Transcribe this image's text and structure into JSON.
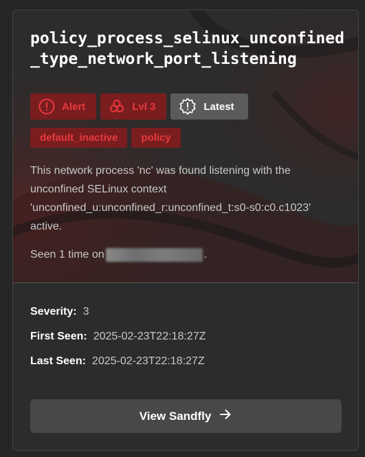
{
  "card": {
    "title": "policy_process_selinux_unconfined_type_network_port_listening",
    "badges": [
      {
        "label": "Alert",
        "icon": "alert-circle-icon",
        "style": "red"
      },
      {
        "label": "Lvl 3",
        "icon": "biohazard-icon",
        "style": "red"
      },
      {
        "label": "Latest",
        "icon": "starburst-alert-icon",
        "style": "grey"
      }
    ],
    "tags": [
      "default_inactive",
      "policy"
    ],
    "description": "This network process 'nc' was found listening with the unconfined SELinux context 'unconfined_u:unconfined_r:unconfined_t:s0-s0:c0.c1023' active.",
    "seen_prefix": "Seen 1 time on",
    "seen_suffix": "."
  },
  "details": {
    "severity_label": "Severity:",
    "severity_value": "3",
    "first_seen_label": "First Seen:",
    "first_seen_value": "2025-02-23T22:18:27Z",
    "last_seen_label": "Last Seen:",
    "last_seen_value": "2025-02-23T22:18:27Z"
  },
  "action": {
    "label": "View Sandfly",
    "icon": "arrow-right-icon"
  },
  "colors": {
    "alert_red": "#e8393d",
    "alert_bg": "#7a1d1f",
    "latest_bg": "#5a5b5b",
    "button_bg": "#474848"
  }
}
